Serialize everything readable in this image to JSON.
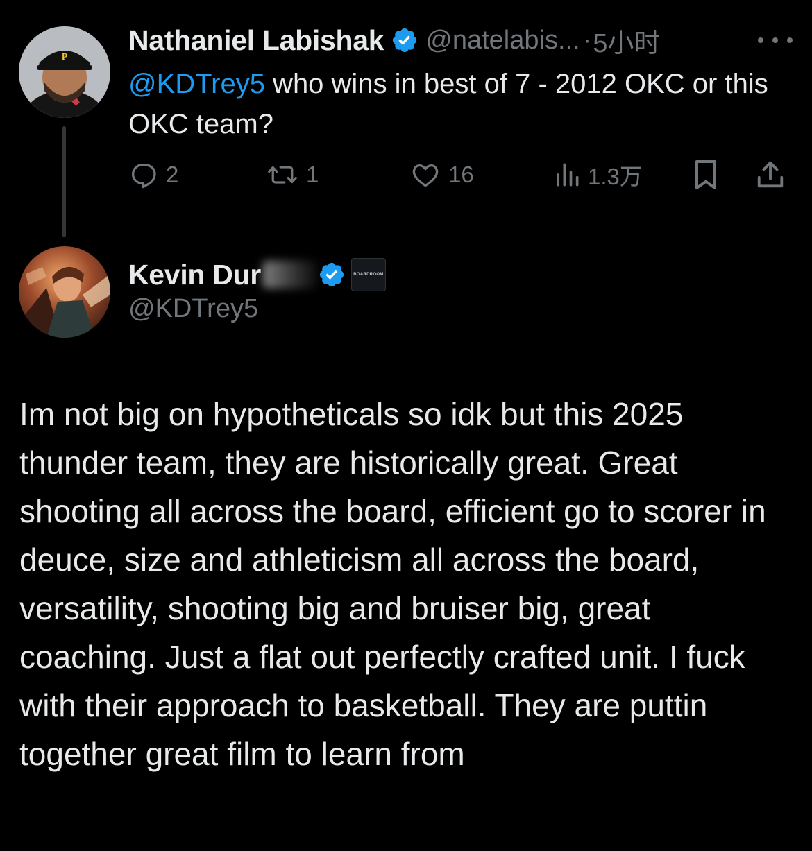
{
  "parent_tweet": {
    "author_name": "Nathaniel Labishak",
    "handle": "@natelabis...",
    "separator": "·",
    "time": "5小时",
    "mention": "@KDTrey5",
    "text": " who wins in best of 7 - 2012 OKC or this OKC team?",
    "stats": {
      "replies": "2",
      "reposts": "1",
      "likes": "16",
      "views": "1.3万"
    },
    "icons": {
      "reply": "reply-icon",
      "repost": "repost-icon",
      "like": "heart-icon",
      "views": "views-chart-icon",
      "bookmark": "bookmark-icon",
      "share": "share-icon",
      "more": "more-icon",
      "verified": "verified-badge-icon"
    }
  },
  "reply_tweet": {
    "author_name": "Kevin Dur",
    "handle": "@KDTrey5",
    "affiliate_label": "BOARDROOM",
    "text": "Im not big on hypotheticals so idk but this 2025 thunder team, they are historically great. Great shooting all across the board, efficient go to scorer in deuce, size and athleticism all across the board, versatility, shooting big and bruiser big, great coaching. Just a flat out perfectly crafted unit. I fuck with their approach to basketball. They are puttin together great film to learn from"
  },
  "colors": {
    "background": "#000000",
    "text_primary": "#e7e9ea",
    "text_secondary": "#71767b",
    "accent": "#1d9bf0",
    "thread_line": "#333639"
  }
}
